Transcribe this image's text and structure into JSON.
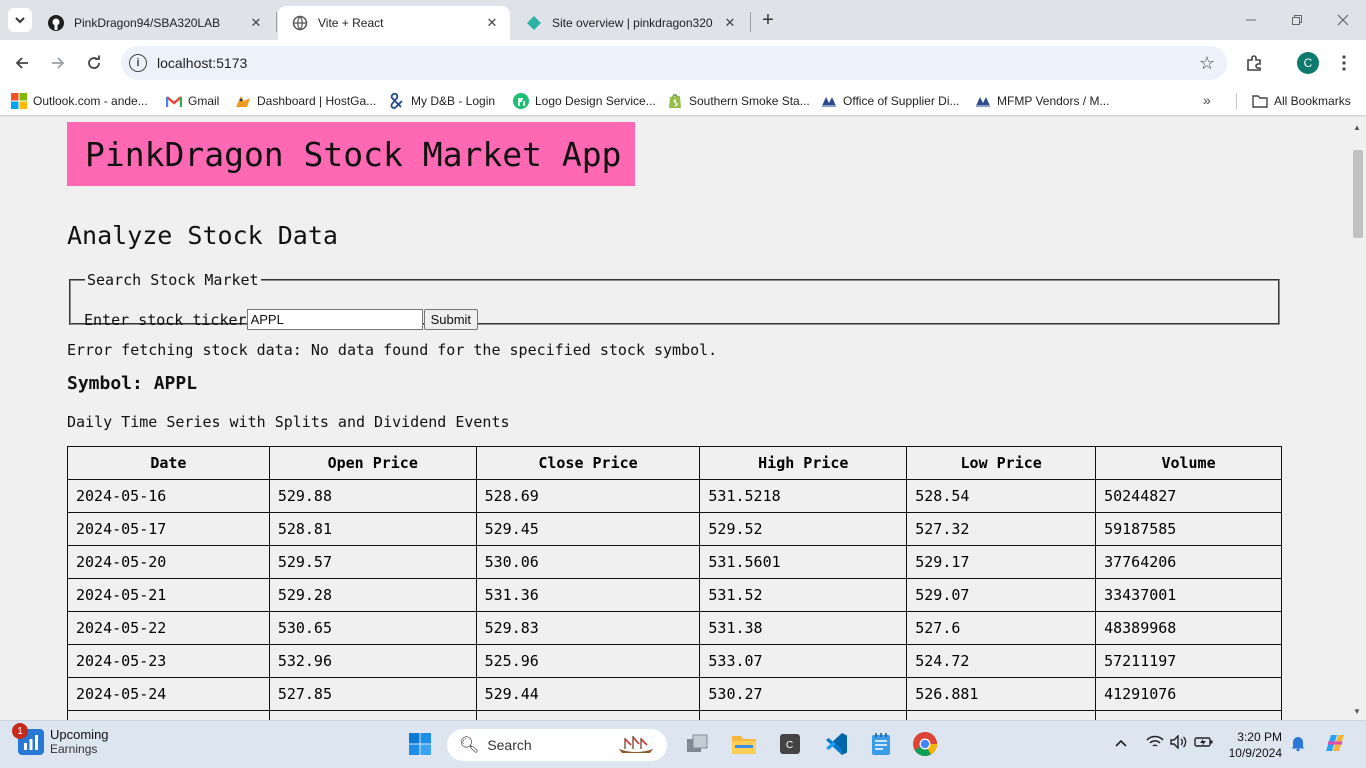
{
  "browser": {
    "tabs": [
      {
        "title": "PinkDragon94/SBA320LAB",
        "icon": "github-icon",
        "active": false
      },
      {
        "title": "Vite + React",
        "icon": "globe-icon",
        "active": true
      },
      {
        "title": "Site overview | pinkdragon320 |",
        "icon": "netlify-icon",
        "active": false
      }
    ],
    "new_tab": "+",
    "url": "localhost:5173",
    "profile_initial": "C",
    "bookmarks": [
      {
        "label": "Outlook.com - ande...",
        "icon": "microsoft-icon"
      },
      {
        "label": "Gmail",
        "icon": "gmail-icon"
      },
      {
        "label": "Dashboard | HostGa...",
        "icon": "hostgator-icon"
      },
      {
        "label": "My D&B - Login",
        "icon": "dnb-icon"
      },
      {
        "label": "Logo Design Service...",
        "icon": "fiverr-icon"
      },
      {
        "label": "Southern Smoke Sta...",
        "icon": "shopify-icon"
      },
      {
        "label": "Office of Supplier Di...",
        "icon": "osd-icon"
      },
      {
        "label": "MFMP Vendors / M...",
        "icon": "mfmp-icon"
      }
    ],
    "all_bookmarks": "All Bookmarks"
  },
  "page": {
    "app_title": "PinkDragon Stock Market App",
    "section_title": "Analyze Stock Data",
    "search": {
      "legend": "Search Stock Market",
      "label": "Enter stock ticker",
      "value": "APPL",
      "submit": "Submit"
    },
    "error": "Error fetching stock data: No data found for the specified stock symbol.",
    "symbol": "Symbol: APPL",
    "series_desc": "Daily Time Series with Splits and Dividend Events",
    "table": {
      "headers": [
        "Date",
        "Open Price",
        "Close Price",
        "High Price",
        "Low Price",
        "Volume"
      ],
      "rows": [
        [
          "2024-05-16",
          "529.88",
          "528.69",
          "531.5218",
          "528.54",
          "50244827"
        ],
        [
          "2024-05-17",
          "528.81",
          "529.45",
          "529.52",
          "527.32",
          "59187585"
        ],
        [
          "2024-05-20",
          "529.57",
          "530.06",
          "531.5601",
          "529.17",
          "37764206"
        ],
        [
          "2024-05-21",
          "529.28",
          "531.36",
          "531.52",
          "529.07",
          "33437001"
        ],
        [
          "2024-05-22",
          "530.65",
          "529.83",
          "531.38",
          "527.6",
          "48389968"
        ],
        [
          "2024-05-23",
          "532.96",
          "525.96",
          "533.07",
          "524.72",
          "57211197"
        ],
        [
          "2024-05-24",
          "527.85",
          "529.44",
          "530.27",
          "526.881",
          "41291076"
        ],
        [
          "",
          "",
          "",
          "",
          "",
          ""
        ]
      ]
    }
  },
  "taskbar": {
    "widget_badge": "1",
    "widget_line1": "Upcoming",
    "widget_line2": "Earnings",
    "search_placeholder": "Search",
    "time": "3:20 PM",
    "date": "10/9/2024"
  },
  "colors": {
    "header_bg": "#ff69b4",
    "page_bg": "#f0f0f0"
  }
}
